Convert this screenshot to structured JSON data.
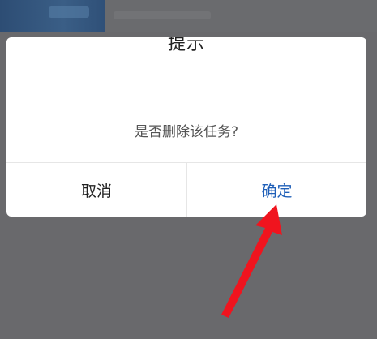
{
  "dialog": {
    "title": "提示",
    "message": "是否删除该任务?",
    "cancel_label": "取消",
    "confirm_label": "确定"
  },
  "colors": {
    "overlay": "#6d6d70",
    "dialog_bg": "#ffffff",
    "confirm_text": "#1f5fb8",
    "arrow": "#f0141e"
  },
  "icons": {
    "annotation": "red-arrow-icon"
  }
}
